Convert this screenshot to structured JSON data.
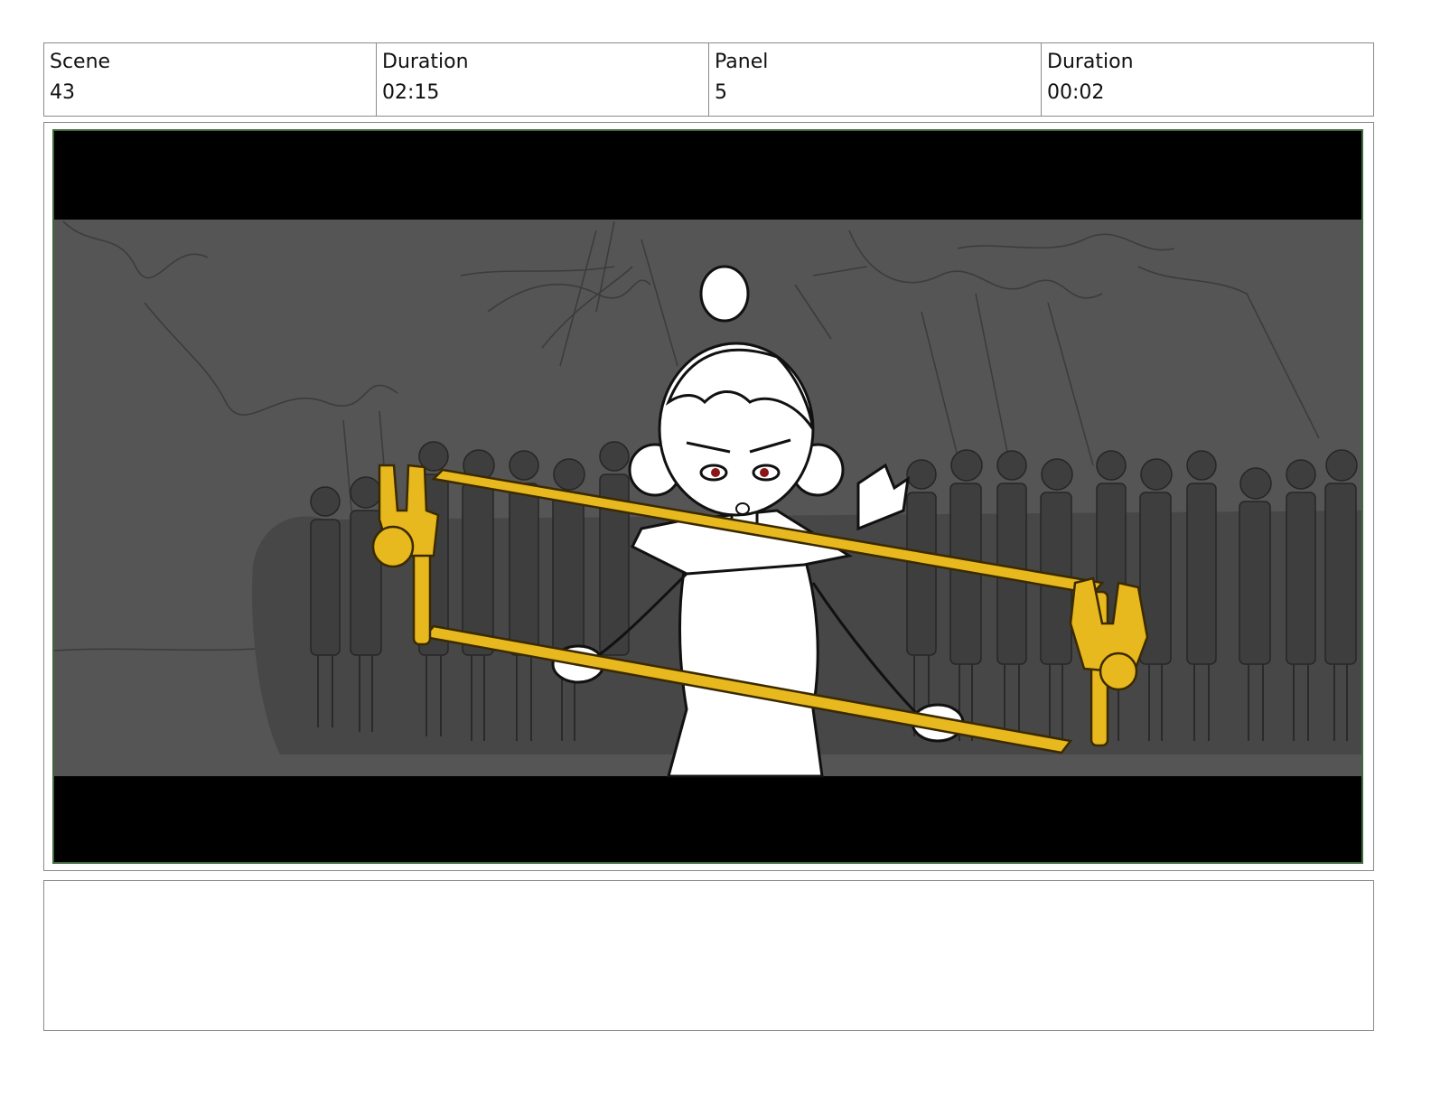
{
  "header": {
    "scene_label": "Scene",
    "scene_value": "43",
    "scene_duration_label": "Duration",
    "scene_duration_value": "02:15",
    "panel_label": "Panel",
    "panel_value": "5",
    "panel_duration_label": "Duration",
    "panel_duration_value": "00:02"
  },
  "panel_art": {
    "subject": "storyboard-sketch",
    "colors": {
      "letterbox": "#000000",
      "background": "#555555",
      "crowd": "#3e3e3e",
      "frame_accent": "#3f6a3c",
      "gold_object": "#e8b81f"
    }
  },
  "notes": {
    "text": ""
  }
}
